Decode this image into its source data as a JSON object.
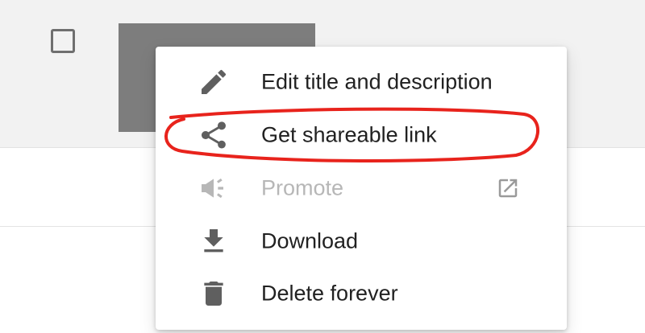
{
  "menu": {
    "items": [
      {
        "label": "Edit title and description",
        "icon": "pencil-icon",
        "enabled": true
      },
      {
        "label": "Get shareable link",
        "icon": "share-icon",
        "enabled": true
      },
      {
        "label": "Promote",
        "icon": "megaphone-icon",
        "enabled": false,
        "trailing_icon": "open-in-new-icon"
      },
      {
        "label": "Download",
        "icon": "download-icon",
        "enabled": true
      },
      {
        "label": "Delete forever",
        "icon": "trash-icon",
        "enabled": true
      }
    ]
  },
  "colors": {
    "icon": "#5f5f5f",
    "icon_disabled": "#b7b7b7",
    "text": "#212121",
    "text_disabled": "#b7b7b7",
    "thumbnail": "#7d7d7d",
    "annotation": "#e8231c"
  }
}
